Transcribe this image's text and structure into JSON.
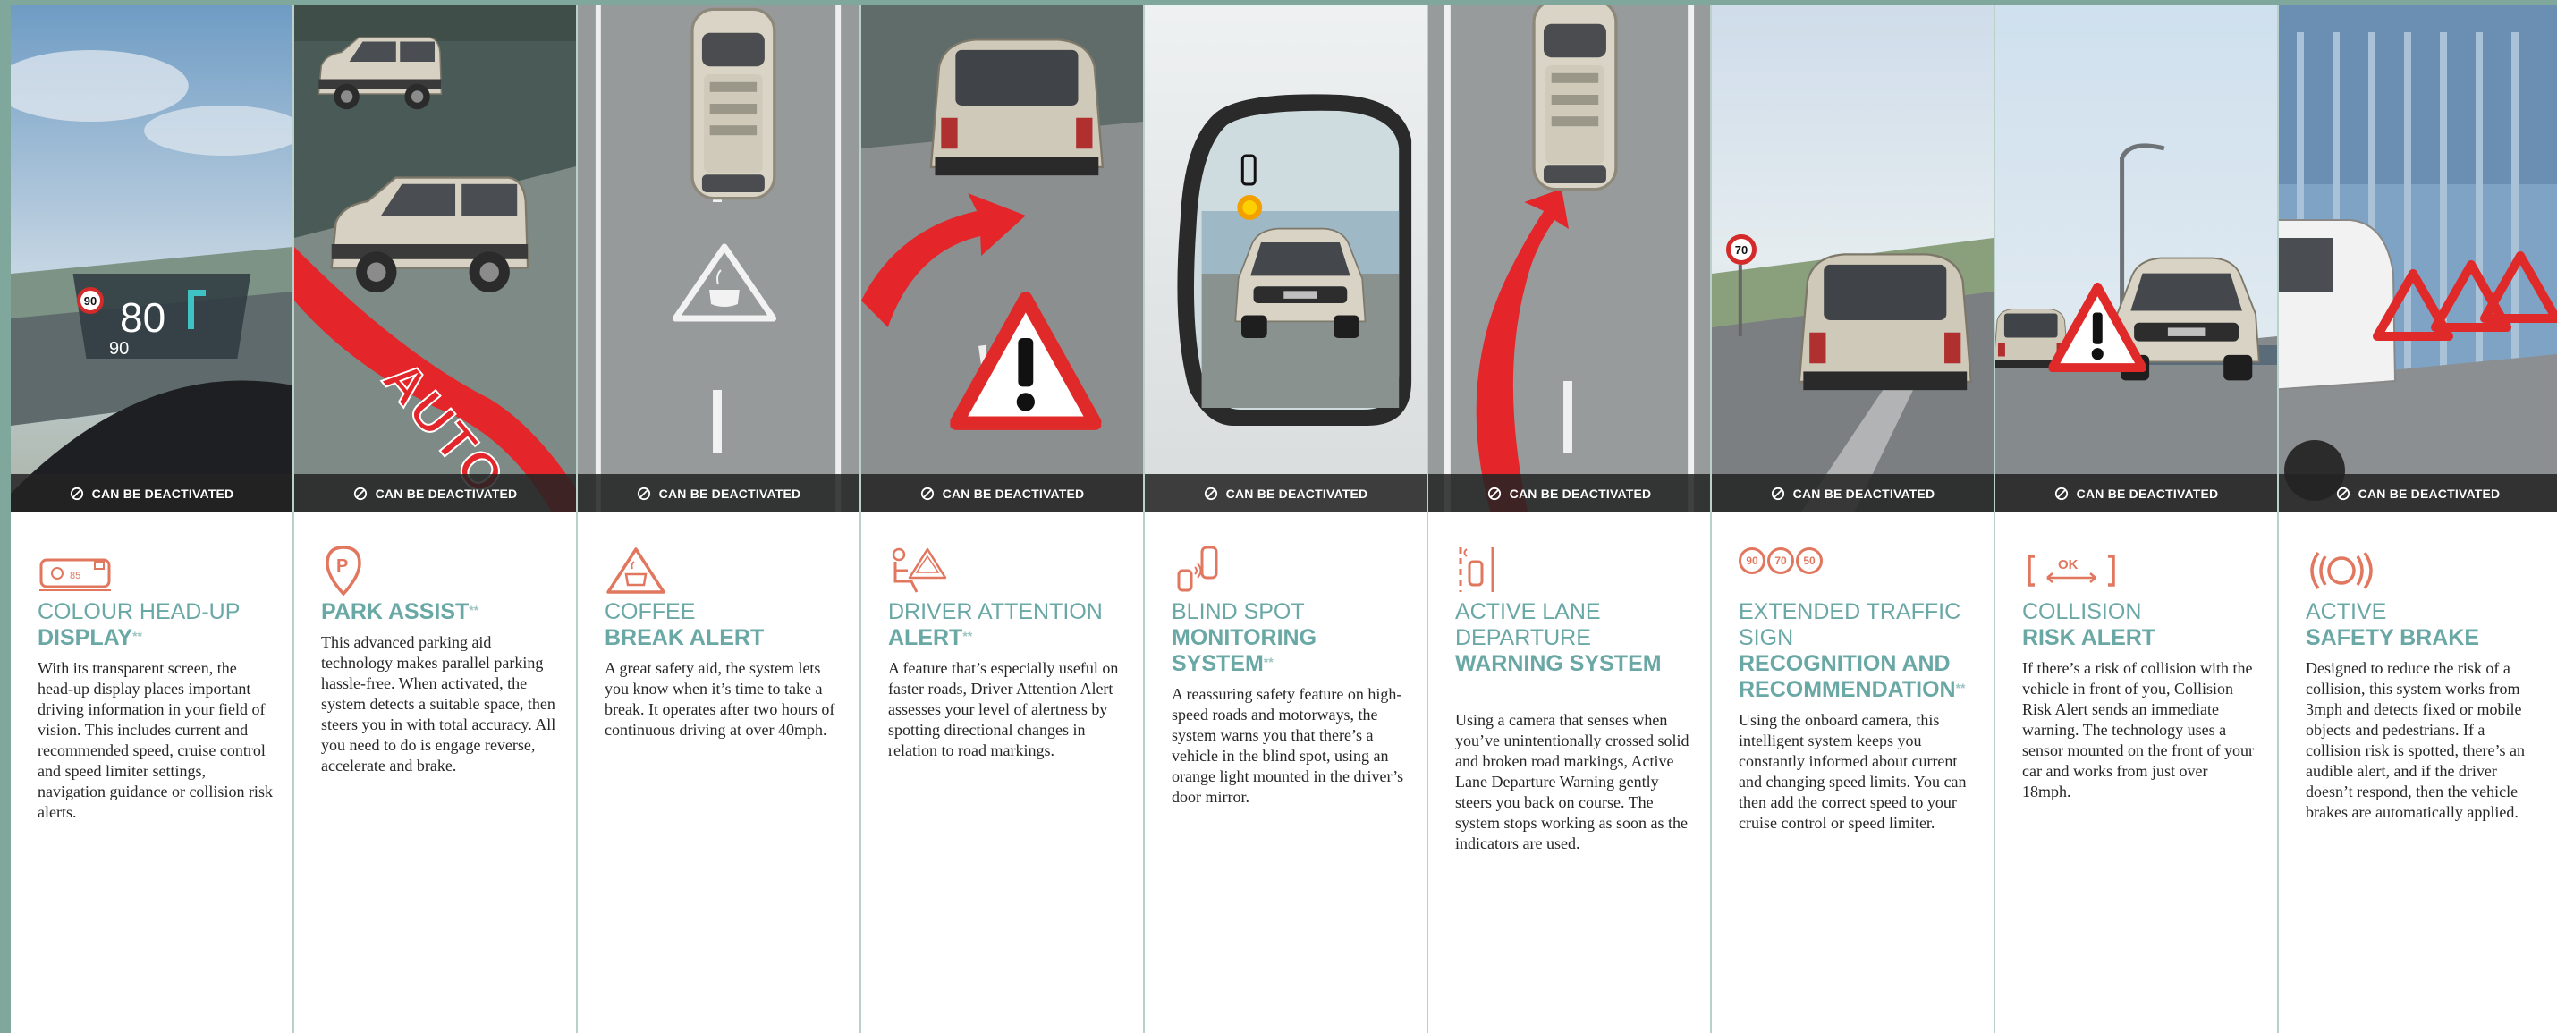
{
  "deactivation_label": "CAN BE DEACTIVATED",
  "colors": {
    "accent_teal": "#6aa8a6",
    "icon_coral": "#e2775f",
    "frame_green": "#7fa79b"
  },
  "features": [
    {
      "icon": "head-up-display-icon",
      "title_line1": "COLOUR HEAD-UP",
      "title_line2": "DISPLAY",
      "title_suffix": "**",
      "description": "With its transparent screen, the head-up display places important driving information in your field of vision. This includes current and recommended speed, cruise control and speed limiter settings, navigation guidance or collision risk alerts.",
      "photo": {
        "speed_limit": "90",
        "current_speed": "80",
        "set_speed": "90",
        "small_display": "85"
      }
    },
    {
      "icon": "park-assist-icon",
      "title_line1": "",
      "title_line2": "PARK ASSIST",
      "title_suffix": "**",
      "description": "This advanced parking aid technology makes parallel parking hassle-free. When activated, the system detects a suitable space, then steers you in with total accuracy. All you need to do is engage reverse, accelerate and brake.",
      "photo": {
        "road_text": "AUTO"
      }
    },
    {
      "icon": "coffee-cup-icon",
      "title_line1": "COFFEE",
      "title_line2": "BREAK ALERT",
      "title_suffix": "",
      "description": "A great safety aid, the system lets you know when it’s time to take a break. It operates after two hours of continuous driving at over 40mph."
    },
    {
      "icon": "driver-attention-icon",
      "title_line1": "DRIVER ATTENTION",
      "title_line2": "ALERT",
      "title_suffix": "**",
      "description": "A feature that’s especially useful on faster roads, Driver Attention Alert assesses your level of alertness by spotting directional changes in relation to road markings."
    },
    {
      "icon": "blind-spot-icon",
      "title_line1": "BLIND SPOT",
      "title_line2": "MONITORING SYSTEM",
      "title_suffix": "**",
      "description": "A reassuring safety feature on high-speed roads and motorways, the system warns you that there’s a vehicle in the blind spot, using an orange light mounted in the driver’s door mirror."
    },
    {
      "icon": "lane-departure-icon",
      "title_line1": "ACTIVE LANE DEPARTURE",
      "title_line2": "WARNING SYSTEM",
      "title_suffix": "",
      "description": "Using a camera that senses when you’ve unintentionally crossed solid and broken road markings, Active Lane Departure Warning gently steers you back on course. The system stops working as soon as the indicators are used."
    },
    {
      "icon": "traffic-sign-icon",
      "title_line1": "EXTENDED TRAFFIC SIGN",
      "title_line2": "RECOGNITION AND RECOMMENDATION",
      "title_suffix": "**",
      "description": "Using the onboard camera, this intelligent system keeps you constantly informed about current and changing speed limits. You can then add the correct speed to your cruise control or speed limiter.",
      "icon_signs": [
        "90",
        "70",
        "50"
      ],
      "photo": {
        "speed_limit": "70"
      }
    },
    {
      "icon": "collision-risk-icon",
      "title_line1": "COLLISION",
      "title_line2": "RISK ALERT",
      "title_suffix": "",
      "description": "If there’s a risk of collision with the vehicle in front of you, Collision Risk Alert sends an immediate warning. The technology uses a sensor mounted on the front of your car and works from just over 18mph.",
      "icon_text": "OK"
    },
    {
      "icon": "safety-brake-icon",
      "title_line1": "ACTIVE",
      "title_line2": "SAFETY BRAKE",
      "title_suffix": "",
      "description": "Designed to reduce the risk of a collision, this system works from 3mph and detects fixed or mobile objects and pedestrians. If a collision risk is spotted, there’s an audible alert, and if the driver doesn’t respond, then the vehicle brakes are automatically applied."
    }
  ]
}
